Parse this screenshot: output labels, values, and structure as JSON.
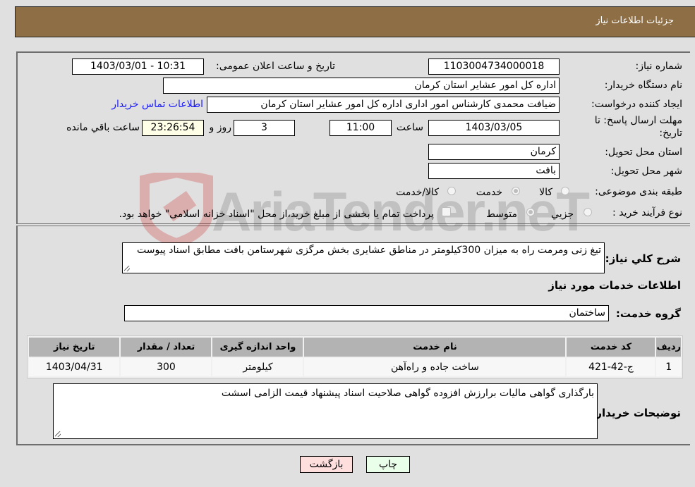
{
  "header": {
    "title": "جزئیات اطلاعات نیاز"
  },
  "form": {
    "need_number": {
      "label": "شماره نیاز:",
      "value": "1103004734000018"
    },
    "announce_datetime": {
      "label": "تاریخ و ساعت اعلان عمومی:",
      "value": "1403/03/01 - 10:31"
    },
    "buyer_org": {
      "label": "نام دستگاه خریدار:",
      "value": "اداره کل امور عشایر استان کرمان"
    },
    "requester": {
      "label": "ایجاد کننده درخواست:",
      "value": "ضیافت محمدی کارشناس امور اداری اداره کل امور عشایر استان کرمان"
    },
    "buyer_contact_link": "اطلاعات تماس خریدار",
    "deadline": {
      "label_line1": "مهلت ارسال پاسخ: تا",
      "label_line2": "تاریخ:",
      "date": "1403/03/05",
      "time_label": "ساعت",
      "time": "11:00",
      "days": "3",
      "days_label": "روز و",
      "remaining": "23:26:54",
      "remaining_label": "ساعت باقي مانده"
    },
    "province": {
      "label": "استان محل تحویل:",
      "value": "کرمان"
    },
    "city": {
      "label": "شهر محل تحویل:",
      "value": "بافت"
    },
    "category": {
      "label": "طبقه بندی موضوعی:",
      "options": [
        "کالا",
        "خدمت",
        "کالا/خدمت"
      ],
      "selected": "خدمت"
    },
    "process_type": {
      "label": "نوع فرآیند خرید :",
      "options": [
        "جزيي",
        "متوسط"
      ],
      "selected": "متوسط",
      "treasury_note": "پرداخت تمام یا بخشی از مبلغ خرید،از محل \"اسناد خزانه اسلامی\" خواهد بود."
    }
  },
  "description": {
    "label": "شرح کلي نياز:",
    "value": "تیغ زنی ومرمت راه به میزان 300کیلومتر در مناطق عشایری بخش مرگزی شهرستامن بافت مطابق اسناد پیوست"
  },
  "services": {
    "section_title": "اطلاعات خدمات مورد نیاز",
    "group_label": "گروه خدمت:",
    "group_value": "ساختمان",
    "table": {
      "headers": [
        "ردیف",
        "کد خدمت",
        "نام خدمت",
        "واحد اندازه گیری",
        "تعداد / مقدار",
        "تاریخ نیاز"
      ],
      "rows": [
        [
          "1",
          "ج-42-421",
          "ساخت جاده و راه‌آهن",
          "کیلومتر",
          "300",
          "1403/04/31"
        ]
      ]
    }
  },
  "buyer_notes": {
    "label": "توضیحات خریدار:",
    "value": "بارگذاری گواهی مالیات برارزش افزوده گواهی صلاحیت اسناد پیشنهاد قیمت الزامی اسشت"
  },
  "buttons": {
    "print": "چاپ",
    "back": "بازگشت"
  },
  "watermark": {
    "text": "AriaTender.neT"
  },
  "colors": {
    "header_bg": "#8e6e44",
    "print_bg": "#eaffea",
    "back_bg": "#ffdede",
    "link": "#1a1aff"
  }
}
